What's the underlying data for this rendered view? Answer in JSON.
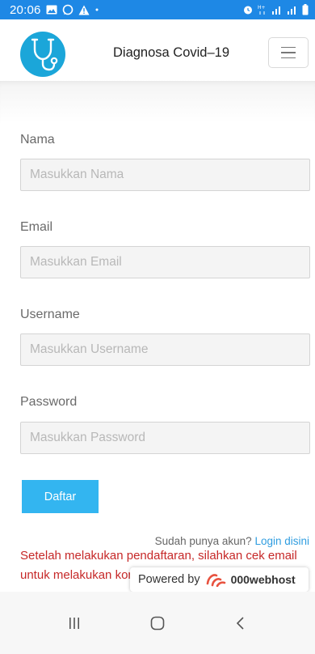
{
  "status": {
    "time": "20:06",
    "left_icons": [
      "gallery-icon",
      "whatsapp-icon",
      "alert-icon",
      "dot-icon"
    ],
    "right_icons": [
      "alarm-icon",
      "data-icon",
      "signal-icon",
      "signal-icon",
      "battery-icon"
    ]
  },
  "navbar": {
    "brand": "Diagnosa Covid–19",
    "logo_icon": "stethoscope-icon",
    "toggler_icon": "hamburger-icon"
  },
  "form": {
    "nama_label": "Nama",
    "nama_placeholder": "Masukkan Nama",
    "email_label": "Email",
    "email_placeholder": "Masukkan Email",
    "username_label": "Username",
    "username_placeholder": "Masukkan Username",
    "password_label": "Password",
    "password_placeholder": "Masukkan Password",
    "submit_label": "Daftar"
  },
  "login": {
    "prompt": "Sudah punya akun?",
    "link": "Login disini"
  },
  "notice": "Setelah melakukan pendaftaran, silahkan cek email untuk melakukan konfirmasi.",
  "powered": {
    "prefix": "Powered by",
    "host": "000webhost"
  },
  "system_nav": [
    "recents-icon",
    "home-icon",
    "back-icon"
  ],
  "colors": {
    "statusbar": "#1e88e5",
    "button": "#33b5f0",
    "notice": "#c62828",
    "link": "#2f9de0"
  }
}
